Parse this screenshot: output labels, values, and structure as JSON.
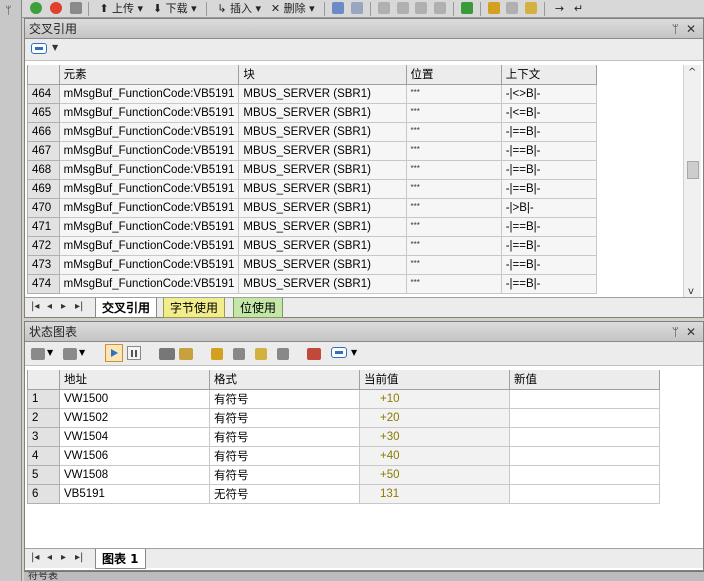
{
  "top_toolbar": {
    "upload_label": "上传",
    "download_label": "下载",
    "insert_label": "插入",
    "delete_label": "删除"
  },
  "xref": {
    "title": "交叉引用",
    "columns": [
      "元素",
      "块",
      "位置",
      "上下文"
    ],
    "rows": [
      {
        "n": "464",
        "element": "mMsgBuf_FunctionCode:VB5191",
        "block": "MBUS_SERVER (SBR1)",
        "pos": "***",
        "ctx": "-|<>B|-"
      },
      {
        "n": "465",
        "element": "mMsgBuf_FunctionCode:VB5191",
        "block": "MBUS_SERVER (SBR1)",
        "pos": "***",
        "ctx": "-|<=B|-"
      },
      {
        "n": "466",
        "element": "mMsgBuf_FunctionCode:VB5191",
        "block": "MBUS_SERVER (SBR1)",
        "pos": "***",
        "ctx": "-|==B|-"
      },
      {
        "n": "467",
        "element": "mMsgBuf_FunctionCode:VB5191",
        "block": "MBUS_SERVER (SBR1)",
        "pos": "***",
        "ctx": "-|==B|-"
      },
      {
        "n": "468",
        "element": "mMsgBuf_FunctionCode:VB5191",
        "block": "MBUS_SERVER (SBR1)",
        "pos": "***",
        "ctx": "-|==B|-"
      },
      {
        "n": "469",
        "element": "mMsgBuf_FunctionCode:VB5191",
        "block": "MBUS_SERVER (SBR1)",
        "pos": "***",
        "ctx": "-|==B|-"
      },
      {
        "n": "470",
        "element": "mMsgBuf_FunctionCode:VB5191",
        "block": "MBUS_SERVER (SBR1)",
        "pos": "***",
        "ctx": "-|>B|-"
      },
      {
        "n": "471",
        "element": "mMsgBuf_FunctionCode:VB5191",
        "block": "MBUS_SERVER (SBR1)",
        "pos": "***",
        "ctx": "-|==B|-"
      },
      {
        "n": "472",
        "element": "mMsgBuf_FunctionCode:VB5191",
        "block": "MBUS_SERVER (SBR1)",
        "pos": "***",
        "ctx": "-|==B|-"
      },
      {
        "n": "473",
        "element": "mMsgBuf_FunctionCode:VB5191",
        "block": "MBUS_SERVER (SBR1)",
        "pos": "***",
        "ctx": "-|==B|-"
      },
      {
        "n": "474",
        "element": "mMsgBuf_FunctionCode:VB5191",
        "block": "MBUS_SERVER (SBR1)",
        "pos": "***",
        "ctx": "-|==B|-"
      }
    ],
    "tabs": [
      "交叉引用",
      "字节使用",
      "位使用"
    ]
  },
  "status": {
    "title": "状态图表",
    "columns": [
      "地址",
      "格式",
      "当前值",
      "新值"
    ],
    "rows": [
      {
        "n": "1",
        "addr": "VW1500",
        "fmt": "有符号",
        "cur": "+10",
        "new": ""
      },
      {
        "n": "2",
        "addr": "VW1502",
        "fmt": "有符号",
        "cur": "+20",
        "new": ""
      },
      {
        "n": "3",
        "addr": "VW1504",
        "fmt": "有符号",
        "cur": "+30",
        "new": ""
      },
      {
        "n": "4",
        "addr": "VW1506",
        "fmt": "有符号",
        "cur": "+40",
        "new": ""
      },
      {
        "n": "5",
        "addr": "VW1508",
        "fmt": "有符号",
        "cur": "+50",
        "new": ""
      },
      {
        "n": "6",
        "addr": "VB5191",
        "fmt": "无符号",
        "cur": "131",
        "new": ""
      }
    ],
    "tabs": [
      "图表 1"
    ]
  },
  "bottom_panel": {
    "title": "符号表"
  }
}
